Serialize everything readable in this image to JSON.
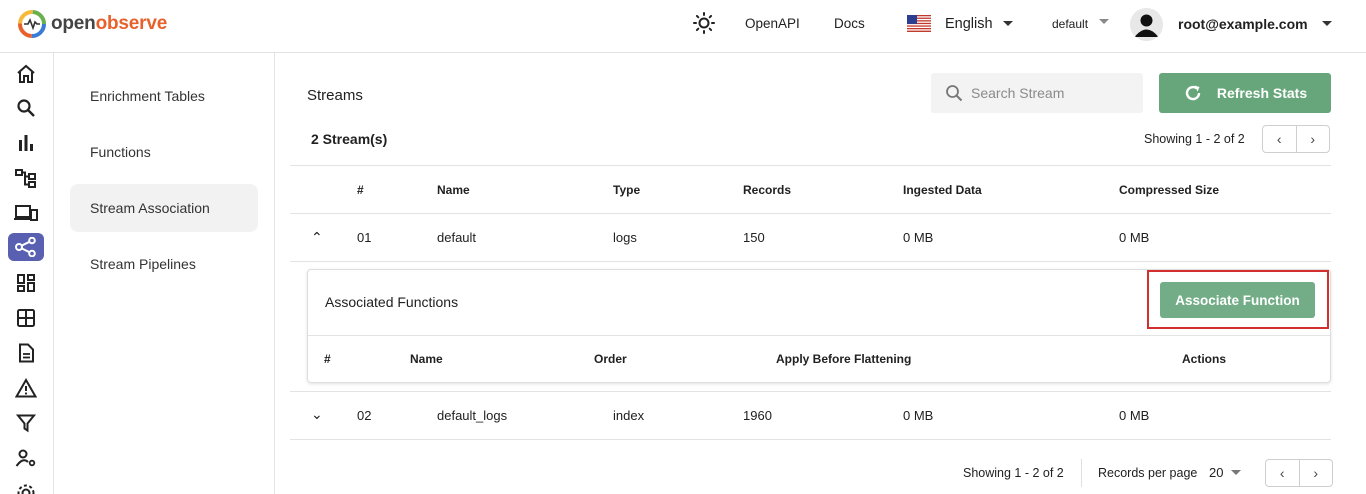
{
  "header": {
    "logo_part1": "open",
    "logo_part2": "observe",
    "openapi": "OpenAPI",
    "docs": "Docs",
    "language": "English",
    "org": "default",
    "user": "root@example.com"
  },
  "rail": {
    "icons": [
      "home-icon",
      "search-icon",
      "bar-chart-icon",
      "hierarchy-icon",
      "devices-icon",
      "share-icon",
      "dashboard-icon",
      "grid-icon",
      "document-icon",
      "alert-icon",
      "filter-icon",
      "user-settings-icon",
      "settings-icon"
    ],
    "active": "share-icon"
  },
  "subnav": {
    "items": [
      "Enrichment Tables",
      "Functions",
      "Stream Association",
      "Stream Pipelines"
    ],
    "active": "Stream Association"
  },
  "main": {
    "title": "Streams",
    "search_placeholder": "Search Stream",
    "refresh_label": "Refresh Stats",
    "stream_count": "2 Stream(s)",
    "showing_top": "Showing 1 - 2 of 2",
    "columns": [
      "#",
      "Name",
      "Type",
      "Records",
      "Ingested Data",
      "Compressed Size"
    ],
    "rows": [
      {
        "toggle": "⌃",
        "num": "01",
        "name": "default",
        "type": "logs",
        "records": "150",
        "ingested": "0 MB",
        "compressed": "0 MB",
        "expanded": true
      },
      {
        "toggle": "⌄",
        "num": "02",
        "name": "default_logs",
        "type": "index",
        "records": "1960",
        "ingested": "0 MB",
        "compressed": "0 MB",
        "expanded": false
      }
    ],
    "associated": {
      "title": "Associated Functions",
      "button": "Associate Function",
      "columns": [
        "#",
        "Name",
        "Order",
        "Apply Before Flattening",
        "Actions"
      ]
    },
    "footer": {
      "showing": "Showing 1 - 2 of 2",
      "records_per_page_label": "Records per page",
      "records_per_page": "20"
    }
  },
  "colors": {
    "accent": "#5960b2",
    "primary_button": "#67a67a",
    "highlight": "#d32f2f"
  }
}
